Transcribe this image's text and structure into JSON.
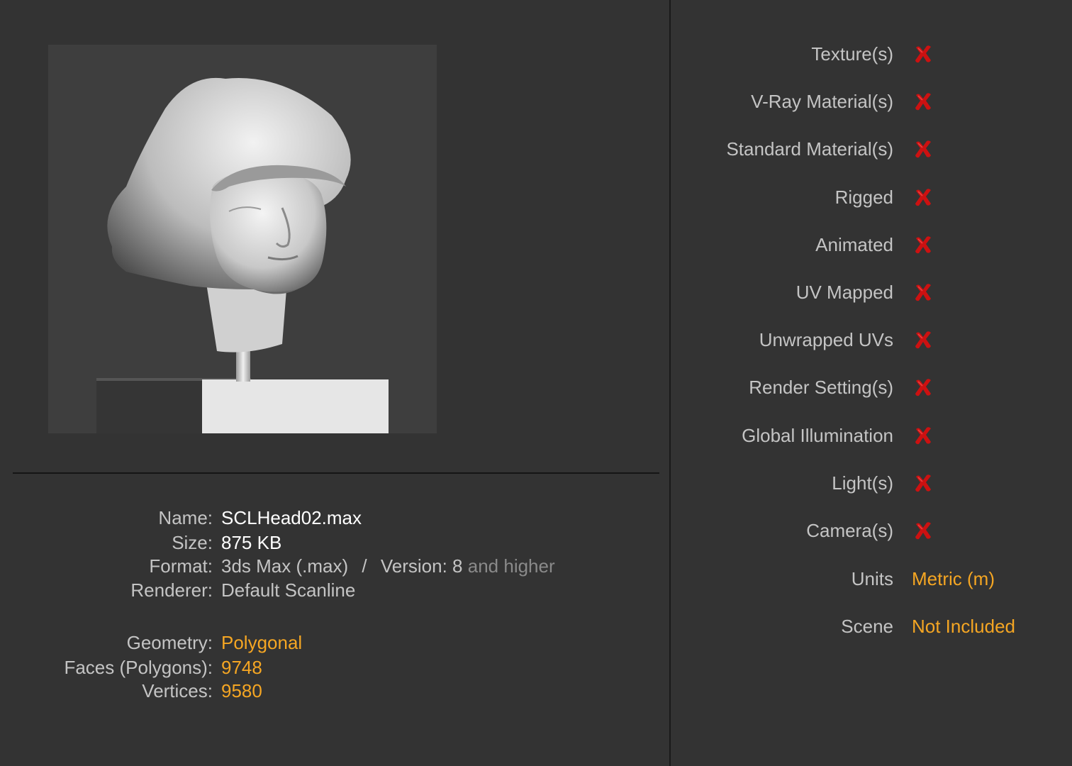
{
  "preview": {
    "icon": "model-preview-render"
  },
  "file_info": {
    "name_label": "Name:",
    "name_value": "SCLHead02.max",
    "size_label": "Size:",
    "size_value": "875 KB",
    "format_label": "Format:",
    "format_value": "3ds Max (.max)",
    "format_sep": "/",
    "version_label": "Version:",
    "version_value": "8",
    "version_suffix": "and higher",
    "renderer_label": "Renderer:",
    "renderer_value": "Default Scanline",
    "geometry_label": "Geometry:",
    "geometry_value": "Polygonal",
    "faces_label": "Faces (Polygons):",
    "faces_value": "9748",
    "vertices_label": "Vertices:",
    "vertices_value": "9580"
  },
  "features": {
    "items": [
      {
        "label": "Texture(s)",
        "status": "no",
        "icon": "red-x-icon"
      },
      {
        "label": "V-Ray Material(s)",
        "status": "no",
        "icon": "red-x-icon"
      },
      {
        "label": "Standard Material(s)",
        "status": "no",
        "icon": "red-x-icon"
      },
      {
        "label": "Rigged",
        "status": "no",
        "icon": "red-x-icon"
      },
      {
        "label": "Animated",
        "status": "no",
        "icon": "red-x-icon"
      },
      {
        "label": "UV Mapped",
        "status": "no",
        "icon": "red-x-icon"
      },
      {
        "label": "Unwrapped UVs",
        "status": "no",
        "icon": "red-x-icon"
      },
      {
        "label": "Render Setting(s)",
        "status": "no",
        "icon": "red-x-icon"
      },
      {
        "label": "Global Illumination",
        "status": "no",
        "icon": "red-x-icon"
      },
      {
        "label": "Light(s)",
        "status": "no",
        "icon": "red-x-icon"
      },
      {
        "label": "Camera(s)",
        "status": "no",
        "icon": "red-x-icon"
      }
    ],
    "units_label": "Units",
    "units_value": "Metric (m)",
    "scene_label": "Scene",
    "scene_value": "Not Included"
  },
  "colors": {
    "background": "#333333",
    "label_text": "#c4c4c4",
    "value_text": "#ffffff",
    "accent": "#f5a623",
    "no_mark": "#cc1111"
  }
}
